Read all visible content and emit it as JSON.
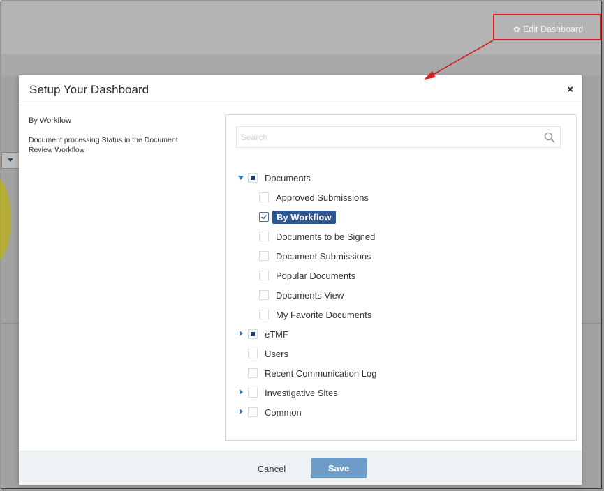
{
  "header": {
    "edit_dashboard_label": "Edit Dashboard",
    "edit_dashboard_icon": "gear-icon"
  },
  "modal": {
    "title": "Setup Your Dashboard",
    "close_label": "×",
    "left": {
      "title": "By Workflow",
      "description": "Document processing Status in the Document Review Workflow"
    },
    "search": {
      "placeholder": "Search",
      "value": "",
      "icon": "search-icon"
    },
    "tree": [
      {
        "label": "Documents",
        "expander": "expanded",
        "state": "partial"
      },
      {
        "label": "Approved Submissions",
        "state": "unchecked"
      },
      {
        "label": "By Workflow",
        "state": "checked",
        "selected": true
      },
      {
        "label": "Documents to be Signed",
        "state": "unchecked"
      },
      {
        "label": "Document Submissions",
        "state": "unchecked"
      },
      {
        "label": "Popular Documents",
        "state": "unchecked"
      },
      {
        "label": "Documents View",
        "state": "unchecked"
      },
      {
        "label": "My Favorite Documents",
        "state": "unchecked"
      },
      {
        "label": "eTMF",
        "expander": "collapsed",
        "state": "partial"
      },
      {
        "label": "Users",
        "state": "unchecked"
      },
      {
        "label": "Recent Communication Log",
        "state": "unchecked"
      },
      {
        "label": "Investigative Sites",
        "expander": "collapsed",
        "state": "unchecked"
      },
      {
        "label": "Common",
        "expander": "collapsed",
        "state": "unchecked"
      }
    ],
    "footer": {
      "cancel_label": "Cancel",
      "save_label": "Save"
    }
  },
  "colors": {
    "accent": "#2f5891",
    "highlight": "#e02020",
    "save": "#6f9dc9"
  }
}
